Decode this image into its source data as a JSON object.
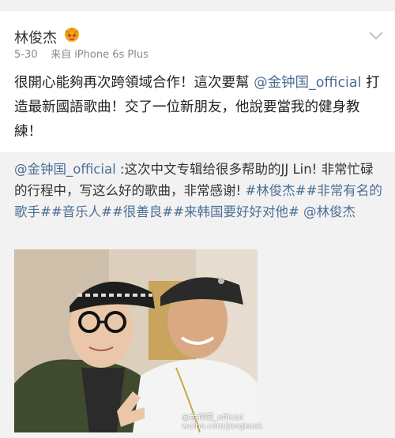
{
  "post": {
    "username": "林俊杰",
    "vip_icon": "crown-badge-icon",
    "date": "5-30",
    "source": "来自 iPhone 6s Plus",
    "text_part1": "很開心能夠再次跨領域合作！這次要幫 ",
    "mention": "@金钟国_official",
    "text_part2": " 打造最新國語歌曲！交了一位新朋友，他說要當我的健身教練！"
  },
  "repost": {
    "mention": "@金钟国_official",
    "text_part1": " :这次中文专辑给很多帮助的JJ Lin! 非常忙碌的行程中，写这么好的歌曲，非常感谢! ",
    "hashtags": "#林俊杰##非常有名的歌手##音乐人##很善良##来韩国要好好对他#",
    "space": " ",
    "mention2": "@林俊杰"
  },
  "photo": {
    "watermark_line1": "@金钟国_official",
    "watermark_line2": "weibo.com/jongkook"
  },
  "colors": {
    "link": "#4c6f95",
    "background": "#ffffff",
    "repost_background": "#f2f2f2"
  }
}
